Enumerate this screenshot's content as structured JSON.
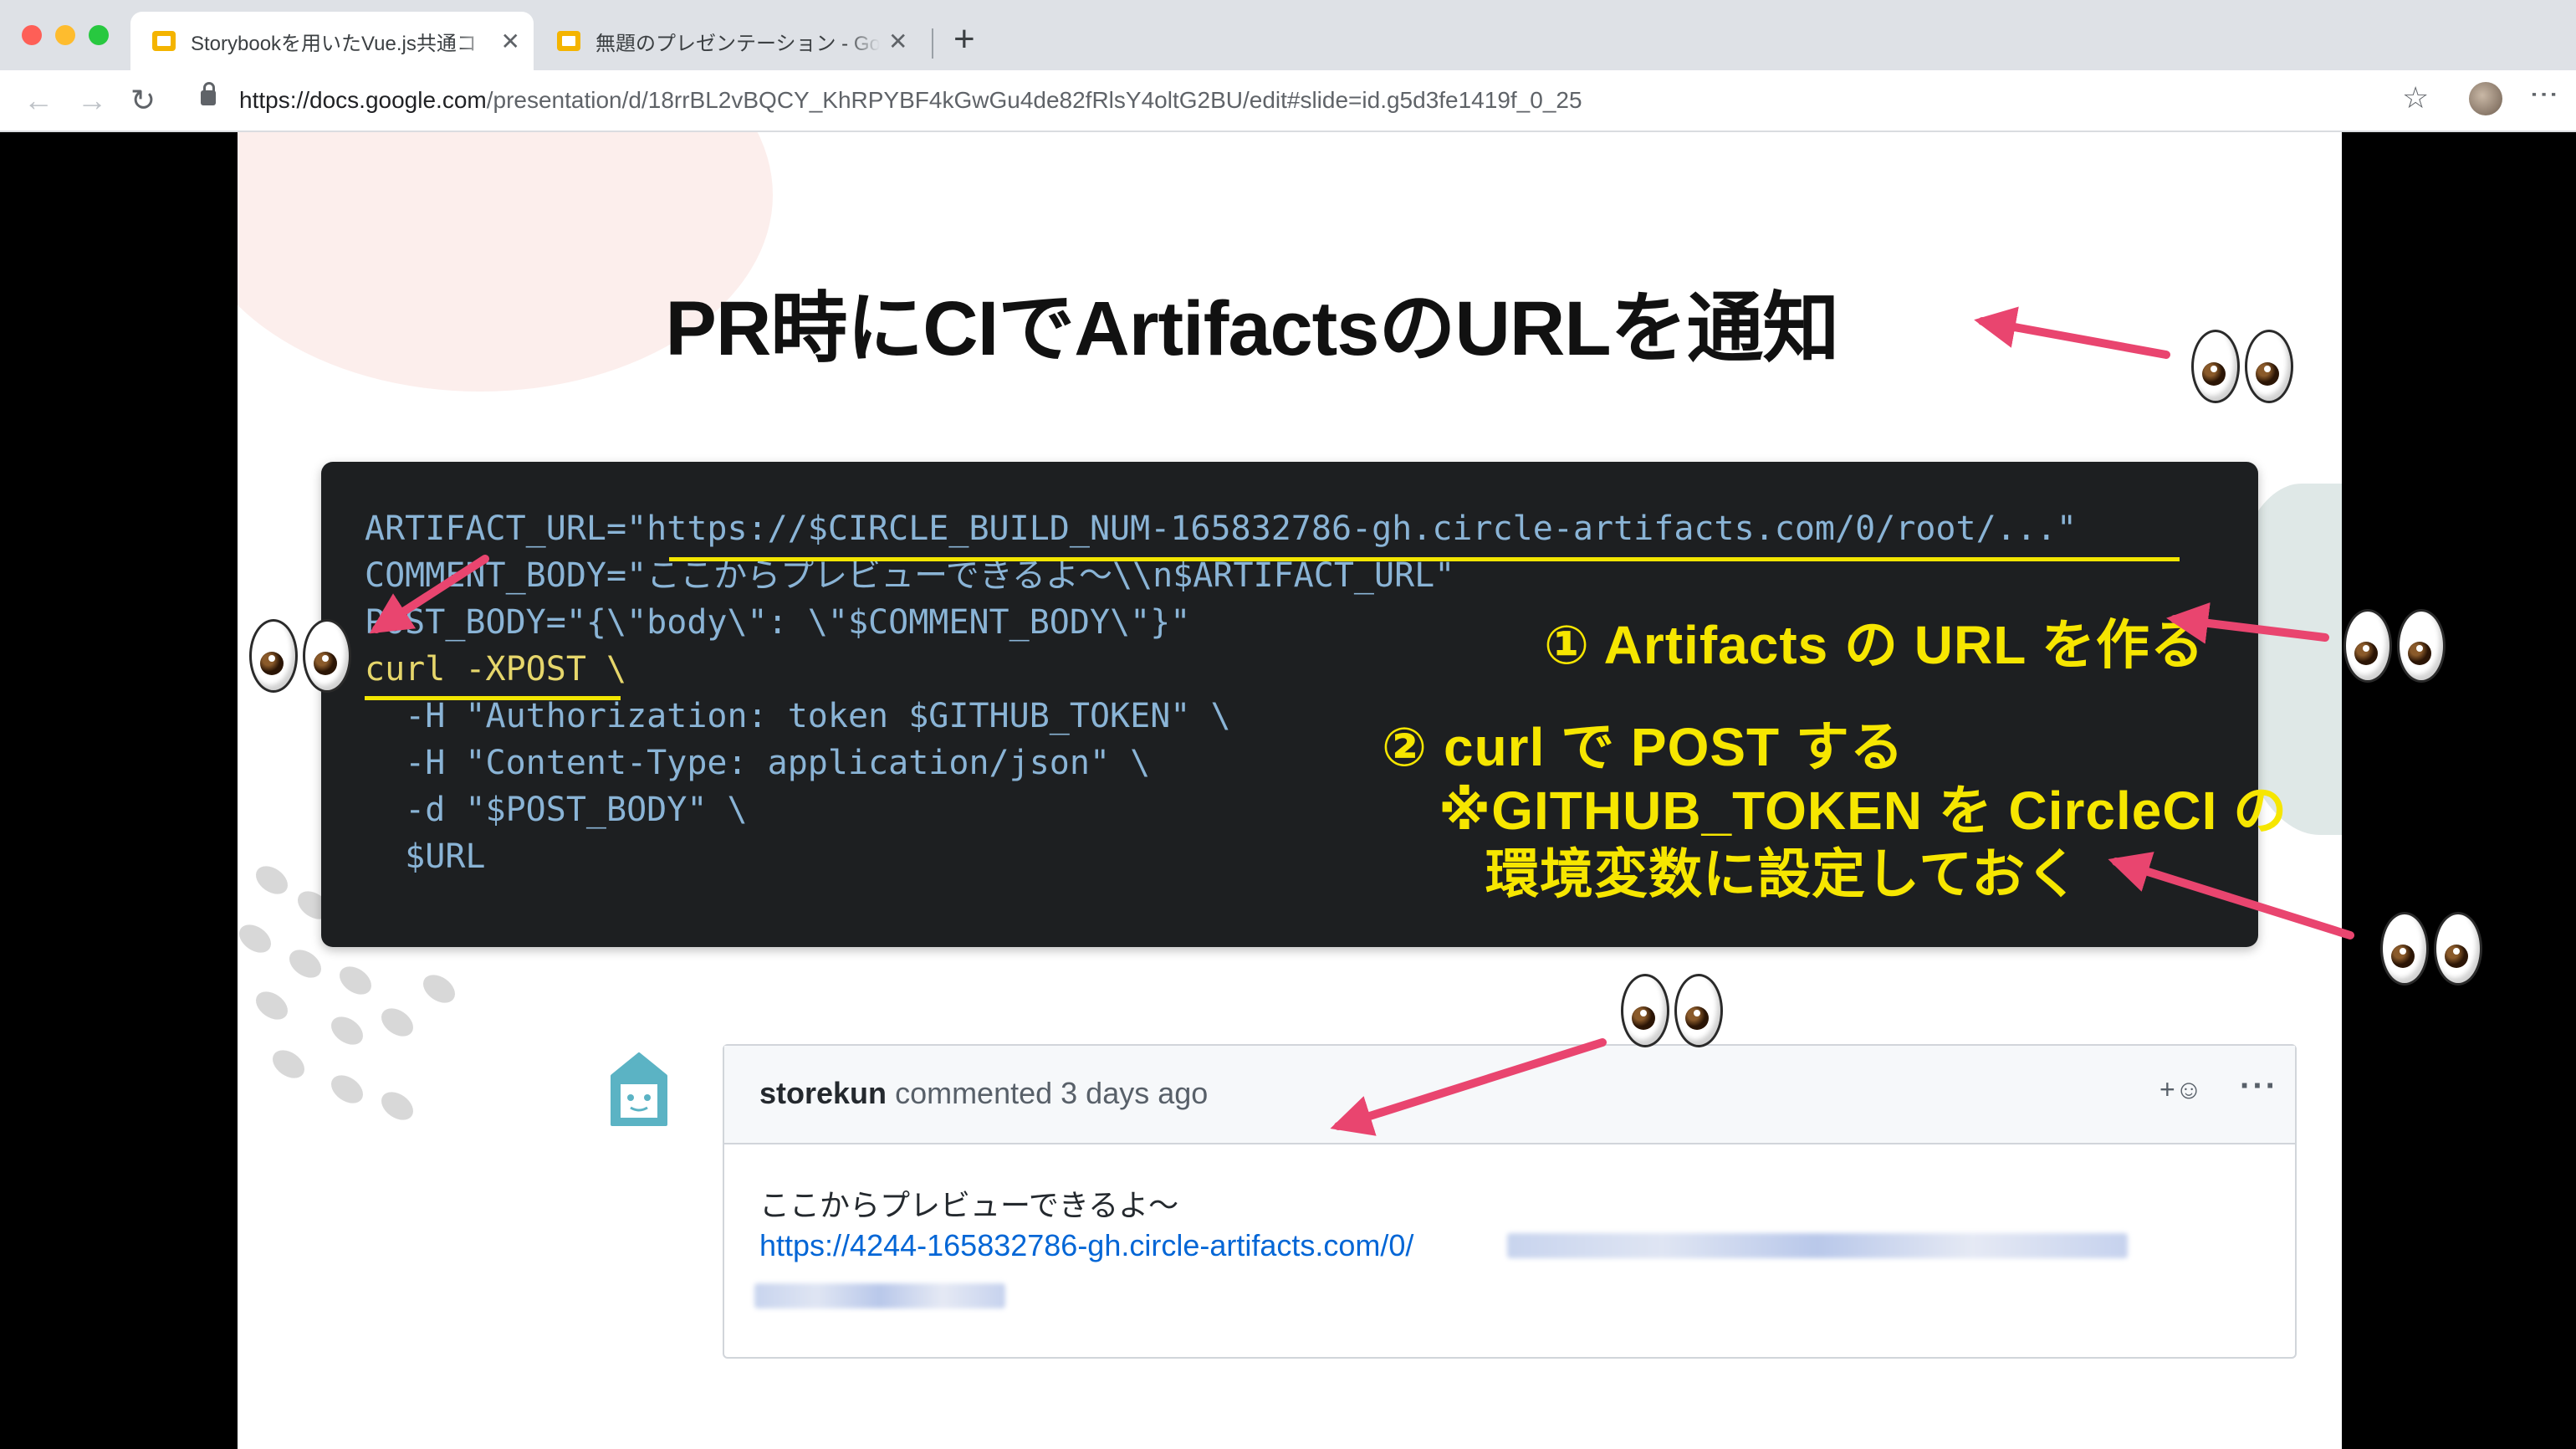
{
  "browser": {
    "tabs": [
      {
        "title": "Storybookを用いたVue.js共通コ",
        "active": true
      },
      {
        "title": "無題のプレゼンテーション - Goog",
        "active": false
      }
    ],
    "close_glyph": "✕",
    "new_tab_glyph": "+",
    "nav": {
      "back": "←",
      "forward": "→",
      "reload": "↻"
    },
    "address": {
      "host": "https://docs.google.com",
      "path": "/presentation/d/18rrBL2vBQCY_KhRPYBF4kGwGu4de82fRlsY4oltG2BU/edit#slide=id.g5d3fe1419f_0_25"
    },
    "star_glyph": "☆",
    "menu_glyph": "⋮"
  },
  "slide": {
    "title": "PR時にCIでArtifactsのURLを通知",
    "code_lines": [
      "ARTIFACT_URL=\"https://$CIRCLE_BUILD_NUM-165832786-gh.circle-artifacts.com/0/root/...\"",
      "COMMENT_BODY=\"ここからプレビューできるよ〜\\\\n$ARTIFACT_URL\"",
      "POST_BODY=\"{\\\"body\\\": \\\"$COMMENT_BODY\\\"}\"",
      "curl -XPOST \\",
      "  -H \"Authorization: token $GITHUB_TOKEN\" \\",
      "  -H \"Content-Type: application/json\" \\",
      "  -d \"$POST_BODY\" \\",
      "  $URL"
    ],
    "annotations": {
      "step1": "① Artifacts の URL を作る",
      "step2": "② curl で POST する",
      "note1": "※GITHUB_TOKEN を CircleCI の",
      "note2": "環境変数に設定しておく"
    },
    "comment": {
      "author": "storekun",
      "meta": "commented 3 days ago",
      "reaction": "+☺",
      "more": "···",
      "body": "ここからプレビューできるよ〜",
      "link": "https://4244-165832786-gh.circle-artifacts.com/0/"
    },
    "colors": {
      "accent_arrow": "#e9456f",
      "highlight": "#f2e600",
      "code_bg": "#1d1f21",
      "code_text": "#8ab4d6",
      "link": "#0366d6"
    },
    "icons": [
      "eyes-emoji",
      "house-bot-avatar"
    ]
  }
}
